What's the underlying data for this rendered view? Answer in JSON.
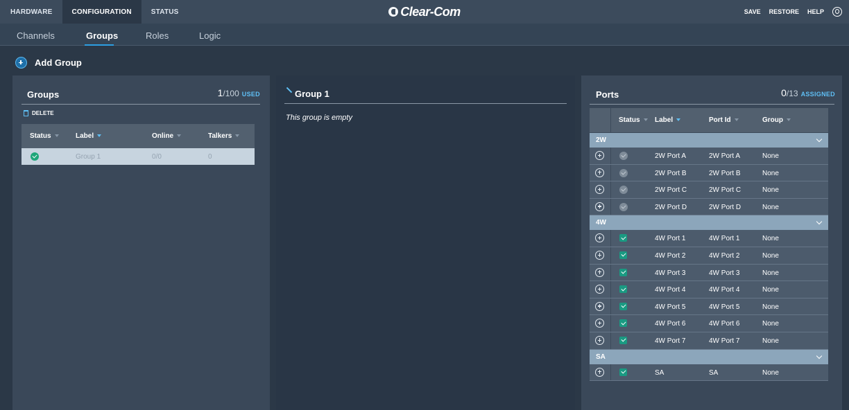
{
  "topbar": {
    "tabs": [
      {
        "label": "HARDWARE"
      },
      {
        "label": "CONFIGURATION"
      },
      {
        "label": "STATUS"
      }
    ],
    "logo": "Clear-Com",
    "actions": {
      "save": "SAVE",
      "restore": "RESTORE",
      "help": "HELP"
    }
  },
  "subnav": {
    "tabs": [
      {
        "label": "Channels"
      },
      {
        "label": "Groups"
      },
      {
        "label": "Roles"
      },
      {
        "label": "Logic"
      }
    ],
    "active": "Groups"
  },
  "add_group": {
    "label": "Add Group"
  },
  "groups_panel": {
    "title": "Groups",
    "used": "1",
    "total": "/100",
    "unit": "USED",
    "delete_label": "DELETE",
    "columns": {
      "status": "Status",
      "label": "Label",
      "online": "Online",
      "talkers": "Talkers"
    },
    "rows": [
      {
        "status": "ok",
        "label": "Group 1",
        "online": "0",
        "online_total": "/0",
        "talkers": "0"
      }
    ]
  },
  "detail_panel": {
    "title": "Group 1",
    "empty_text": "This group is empty"
  },
  "ports_panel": {
    "title": "Ports",
    "assigned": "0",
    "total": "/13",
    "unit": "ASSIGNED",
    "columns": {
      "status": "Status",
      "label": "Label",
      "port_id": "Port Id",
      "group": "Group"
    },
    "groups": [
      {
        "name": "2W",
        "rows": [
          {
            "status": "inactive",
            "label": "2W Port A",
            "port_id": "2W Port A",
            "group": "None"
          },
          {
            "status": "inactive",
            "label": "2W Port B",
            "port_id": "2W Port B",
            "group": "None"
          },
          {
            "status": "inactive",
            "label": "2W Port C",
            "port_id": "2W Port C",
            "group": "None"
          },
          {
            "status": "inactive",
            "label": "2W Port D",
            "port_id": "2W Port D",
            "group": "None"
          }
        ]
      },
      {
        "name": "4W",
        "rows": [
          {
            "status": "active",
            "label": "4W Port 1",
            "port_id": "4W Port 1",
            "group": "None"
          },
          {
            "status": "active",
            "label": "4W Port 2",
            "port_id": "4W Port 2",
            "group": "None"
          },
          {
            "status": "active",
            "label": "4W Port 3",
            "port_id": "4W Port 3",
            "group": "None"
          },
          {
            "status": "active",
            "label": "4W Port 4",
            "port_id": "4W Port 4",
            "group": "None"
          },
          {
            "status": "active",
            "label": "4W Port 5",
            "port_id": "4W Port 5",
            "group": "None"
          },
          {
            "status": "active",
            "label": "4W Port 6",
            "port_id": "4W Port 6",
            "group": "None"
          },
          {
            "status": "active",
            "label": "4W Port 7",
            "port_id": "4W Port 7",
            "group": "None"
          }
        ]
      },
      {
        "name": "SA",
        "rows": [
          {
            "status": "active",
            "label": "SA",
            "port_id": "SA",
            "group": "None"
          }
        ]
      }
    ]
  },
  "colors": {
    "accent": "#2d9fe3",
    "status_ok": "#1fa67a",
    "group_header": "#8ca6bb"
  }
}
